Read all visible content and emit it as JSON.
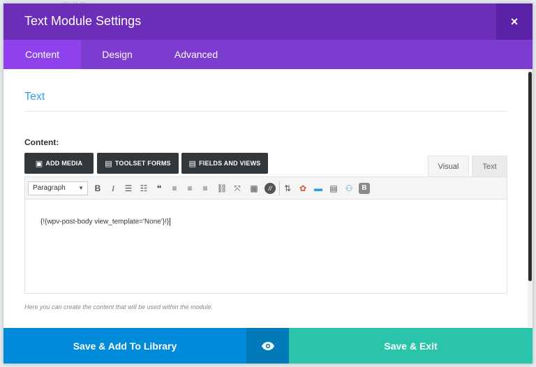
{
  "background": {
    "peek_text": "Full Page"
  },
  "modal": {
    "title": "Text Module Settings",
    "close_glyph": "×"
  },
  "tabs": [
    {
      "label": "Content",
      "active": true
    },
    {
      "label": "Design",
      "active": false
    },
    {
      "label": "Advanced",
      "active": false
    }
  ],
  "section": {
    "title": "Text"
  },
  "content_field": {
    "label": "Content:",
    "media_buttons": [
      {
        "label": "ADD MEDIA",
        "icon": "media-icon"
      },
      {
        "label": "TOOLSET FORMS",
        "icon": "forms-icon"
      },
      {
        "label": "FIELDS AND VIEWS",
        "icon": "fields-icon"
      }
    ],
    "mode_tabs": {
      "visual": "Visual",
      "text": "Text"
    },
    "format_select": "Paragraph",
    "editor_value": "{!{wpv-post-body view_template='None'}!}",
    "help": "Here you can create the content that will be used within the module."
  },
  "footer": {
    "save_library": "Save & Add To Library",
    "save_exit": "Save & Exit",
    "preview_icon": "eye-icon"
  },
  "colors": {
    "header": "#6c2eb9",
    "tabs": "#7e3bd0",
    "active_tab": "#8f42ec",
    "accent_blue": "#2ea3f2",
    "library_button": "#008bdb",
    "preview_button": "#007ab8",
    "exit_button": "#29c4a9"
  }
}
